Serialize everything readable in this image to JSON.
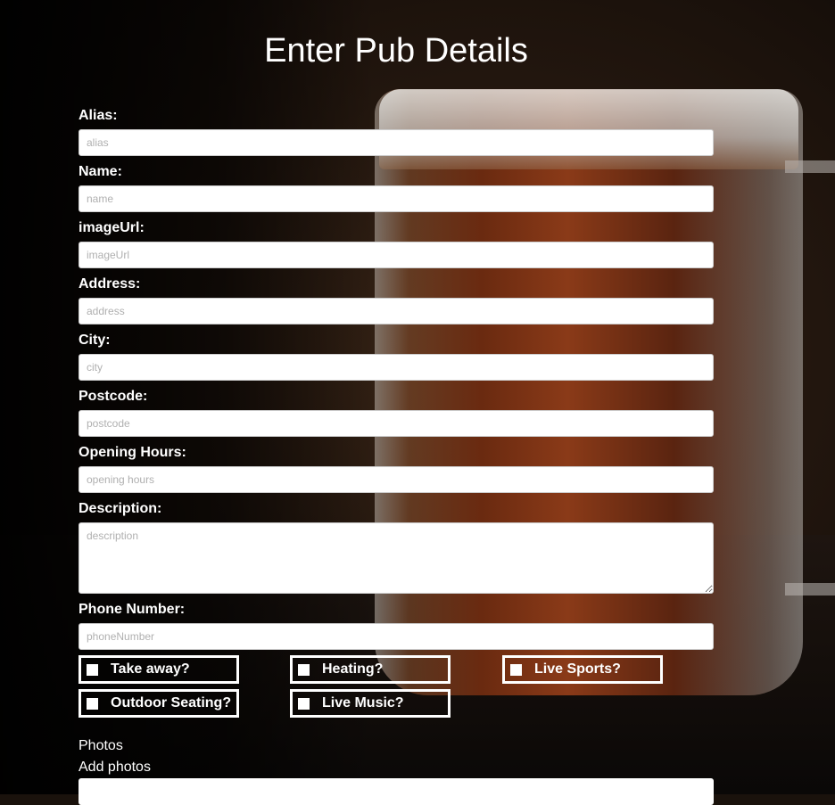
{
  "page": {
    "title": "Enter Pub Details"
  },
  "form": {
    "alias": {
      "label": "Alias:",
      "placeholder": "alias"
    },
    "name": {
      "label": "Name:",
      "placeholder": "name"
    },
    "imageUrl": {
      "label": "imageUrl:",
      "placeholder": "imageUrl"
    },
    "address": {
      "label": "Address:",
      "placeholder": "address"
    },
    "city": {
      "label": "City:",
      "placeholder": "city"
    },
    "postcode": {
      "label": "Postcode:",
      "placeholder": "postcode"
    },
    "openingHours": {
      "label": "Opening Hours:",
      "placeholder": "opening hours"
    },
    "description": {
      "label": "Description:",
      "placeholder": "description"
    },
    "phoneNumber": {
      "label": "Phone Number:",
      "placeholder": "phoneNumber"
    }
  },
  "checkboxes": {
    "takeaway": {
      "label": "Take away?",
      "checked": false
    },
    "heating": {
      "label": "Heating?",
      "checked": false
    },
    "liveSports": {
      "label": "Live Sports?",
      "checked": false
    },
    "outdoorSeating": {
      "label": "Outdoor Seating?",
      "checked": false
    },
    "liveMusic": {
      "label": "Live Music?",
      "checked": false
    }
  },
  "photos": {
    "heading": "Photos",
    "add_label": "Add photos"
  }
}
